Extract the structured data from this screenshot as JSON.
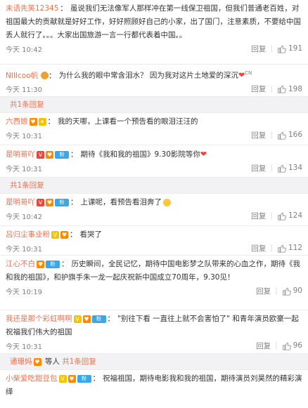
{
  "comments": [
    {
      "user": "未语先笑12345",
      "text": "虽说我们无法像军人那样冲在第一线保卫祖国，但我们普通老百姓，对祖国最大的贡献就是好好工作，好好照顾好自己的小家，出了国门，注意素质，不要给中国丢人就行了。。。大家出国旅游一言一行都代表着中国。。",
      "time": "今天 10:42",
      "likes": "191"
    },
    {
      "user": "NIlIcoo帆",
      "text": "为什么我的眼中常含泪水？ 因为我对这片土地爱的深沉",
      "cn": "CN",
      "time": "今天 11:30",
      "likes": "198"
    },
    {
      "user": "六西娘",
      "text": "我的天哪，上课看一个预告看的眼泪汪汪的",
      "time": "今天 10:31",
      "likes": "166"
    },
    {
      "user": "是明哥吖",
      "text": "期待《我和我的祖国》9.30影院等你",
      "time": "今天 10:31",
      "likes": "134"
    },
    {
      "user": "是明哥吖",
      "text": "上课呢，看预告看泪奔了",
      "time": "今天 10:42",
      "likes": "124"
    },
    {
      "user": "吕归尘事业粉",
      "text": "看哭了",
      "time": "今天 10:31",
      "likes": "112"
    },
    {
      "user": "江心不白",
      "text": "历史瞬间，全民记忆，期待中国电影梦之队带来的心血之作，期待《我和我的祖国》，和护旗手朱一龙一起庆祝新中国成立70周年，9.30见！",
      "time": "今天 10:19",
      "likes": "90"
    },
    {
      "user": "我还是那个彩虹啊啊",
      "text": "\"别往下看 一直往上就不会害怕了\" 和青年演员欧豪一起祝福我们伟大的祖国",
      "time": "今天 10:31",
      "likes": "96"
    },
    {
      "user": "小柴爱吃甜豆包",
      "text": "祝福祖国，期待电影我和我的祖国，期待演员刘昊然的精彩演绎",
      "time": "",
      "likes": ""
    }
  ],
  "reply_bars": {
    "one": "共1条回复",
    "two": "共1条回复",
    "three_user": "通珊妈",
    "three_mid": "等人",
    "three_count": "共1条回复"
  },
  "actions": {
    "reply": "回复",
    "sep": "|"
  },
  "colors": {
    "username": "#eb7350",
    "meta": "#808080",
    "reply_bg": "#f2f2f5"
  }
}
